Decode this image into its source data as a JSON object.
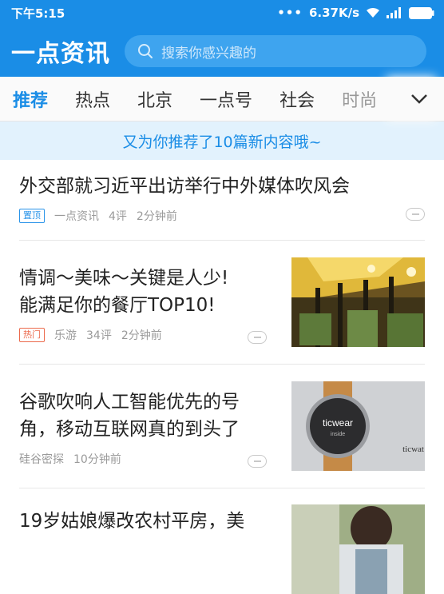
{
  "status": {
    "time": "下午5:15",
    "speed": "6.37K/s"
  },
  "header": {
    "logo": "一点资讯",
    "search_placeholder": "搜索你感兴趣的"
  },
  "tabs": [
    "推荐",
    "热点",
    "北京",
    "一点号",
    "社会",
    "时尚"
  ],
  "notice": "又为你推荐了10篇新内容哦~",
  "articles": [
    {
      "title": "外交部就习近平出访举行中外媒体吹风会",
      "tag": "置顶",
      "source": "一点资讯",
      "comments": "4评",
      "time": "2分钟前"
    },
    {
      "title_line1": "情调～美味～关键是人少!",
      "title_line2": "能满足你的餐厅TOP10!",
      "tag": "热门",
      "source": "乐游",
      "comments": "34评",
      "time": "2分钟前"
    },
    {
      "title_line1": "谷歌吹响人工智能优先的号",
      "title_line2": "角，移动互联网真的到头了",
      "source": "硅谷密探",
      "time": "10分钟前",
      "thumb_brand": "ticwear",
      "thumb_sub": "inside",
      "thumb_brand_corner": "ticwat"
    },
    {
      "title_line1": "19岁姑娘爆改农村平房，美"
    }
  ],
  "colors": {
    "brand": "#1a8de6",
    "tag_top": "#2a94e9",
    "tag_hot": "#ec6a4c",
    "notice_bg": "#e2f2fd"
  }
}
